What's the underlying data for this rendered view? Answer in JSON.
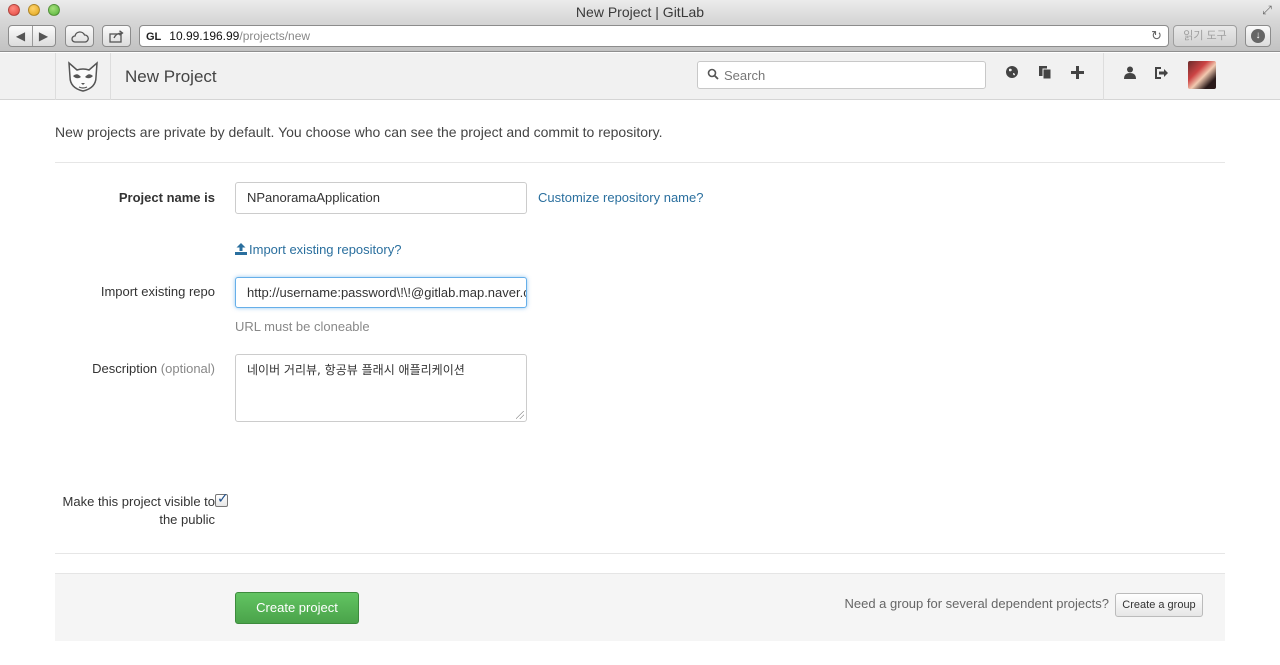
{
  "window": {
    "title": "New Project | GitLab"
  },
  "browser": {
    "favicon_text": "GL",
    "url_host": "10.99.196.99",
    "url_path": "/projects/new",
    "reader_label": "읽기 도구"
  },
  "header": {
    "title": "New Project",
    "search_placeholder": "Search"
  },
  "page": {
    "intro": "New projects are private by default. You choose who can see the project and commit to repository.",
    "project_name_label": "Project name is",
    "project_name_value": "NPanoramaApplication",
    "customize_link": "Customize repository name?",
    "import_link": "Import existing repository?",
    "import_label": "Import existing repo",
    "import_value": "http://username:password\\!\\!@gitlab.map.naver.com/mobile/NPanoramaApplication.git",
    "import_help": "URL must be cloneable",
    "description_label": "Description",
    "description_optional": "(optional)",
    "description_value": "네이버 거리뷰, 항공뷰 플래시 애플리케이션",
    "visible_label": "Make this project visible to the public",
    "visible_checked": true,
    "create_button": "Create project",
    "group_question": "Need a group for several dependent projects?",
    "group_button": "Create a group"
  }
}
